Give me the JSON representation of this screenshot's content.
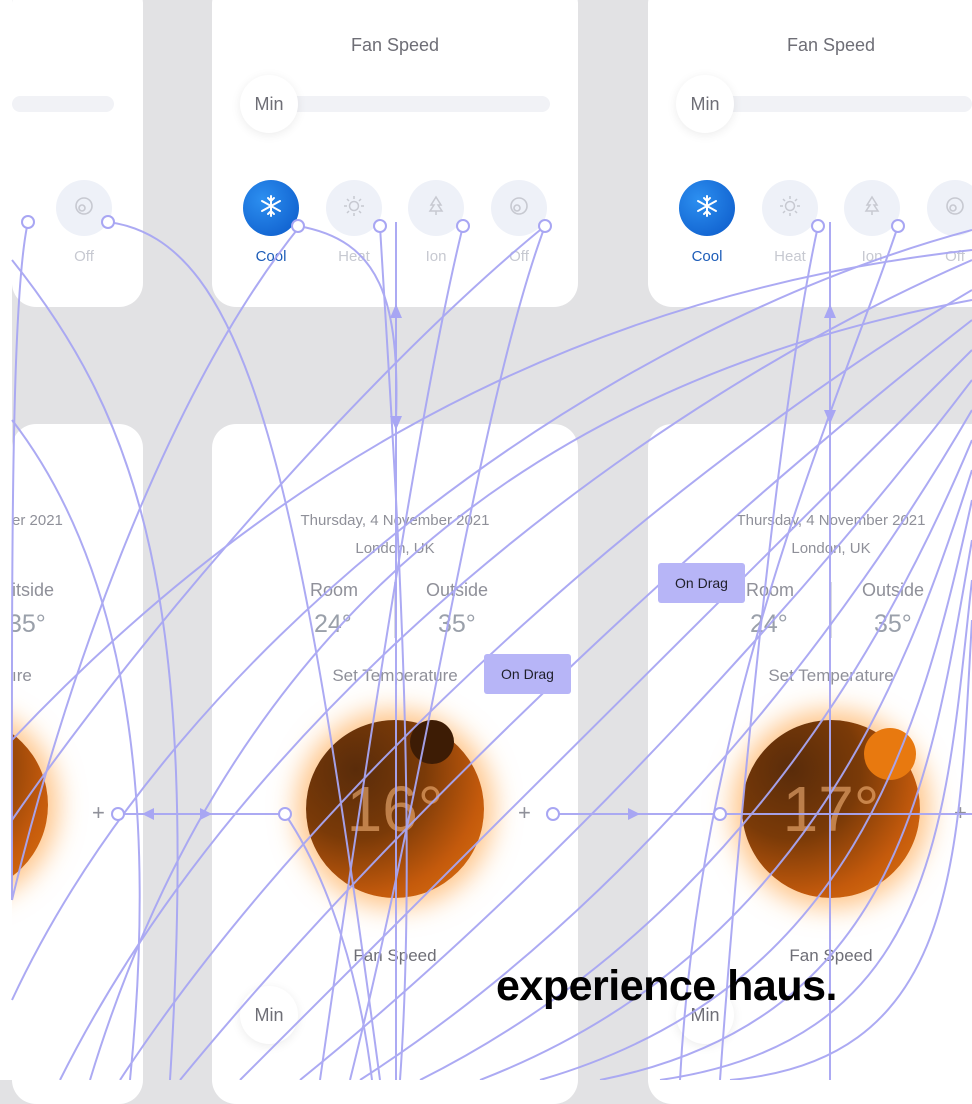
{
  "fan_speed_label": "Fan Speed",
  "min_label": "Min",
  "modes": {
    "cool": "Cool",
    "heat": "Heat",
    "ion": "Ion",
    "off": "Off"
  },
  "date_text": "Thursday, 4 November 2021",
  "location": "London, UK",
  "room_label": "Room",
  "outside_label": "Outside",
  "room_temp": "24°",
  "outside_temp": "35°",
  "set_temperature_label": "Set Temperature",
  "left_card": {
    "date_fragment": "er 2021",
    "outside_fragment": "itside",
    "temp_fragment": "35°",
    "set_fragment": "ıre"
  },
  "card_middle": {
    "target_temp": "16°"
  },
  "card_right": {
    "target_temp": "17°"
  },
  "plus_label": "+",
  "drag_tag": "On Drag",
  "brand": "experience haus.",
  "colors": {
    "accent_blue": "#1565d8",
    "prototype_wire": "#a8a6f3",
    "dial_orange": "#e37812"
  },
  "icons": {
    "cool": "snowflake-icon",
    "heat": "sun-icon",
    "ion": "tree-icon",
    "off": "power-icon"
  }
}
